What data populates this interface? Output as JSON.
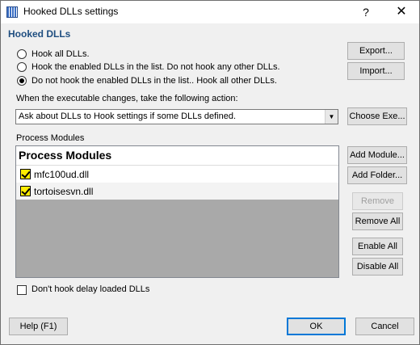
{
  "window": {
    "title": "Hooked DLLs settings",
    "help_glyph": "?",
    "close_glyph": "✕"
  },
  "section_title": "Hooked DLLs",
  "hook_options": [
    {
      "label": "Hook all DLLs.",
      "checked": false
    },
    {
      "label": "Hook the enabled DLLs in the list. Do not hook any other DLLs.",
      "checked": false
    },
    {
      "label": "Do not hook the enabled DLLs in the list.. Hook all other DLLs.",
      "checked": true
    }
  ],
  "buttons": {
    "export": "Export...",
    "import": "Import...",
    "choose_exe": "Choose Exe...",
    "add_module": "Add Module...",
    "add_folder": "Add Folder...",
    "remove": "Remove",
    "remove_all": "Remove All",
    "enable_all": "Enable All",
    "disable_all": "Disable All",
    "help": "Help (F1)",
    "ok": "OK",
    "cancel": "Cancel"
  },
  "exe_change": {
    "label": "When the executable changes, take the following action:",
    "selected": "Ask about DLLs to Hook settings if some DLLs defined."
  },
  "process_modules": {
    "group_label": "Process Modules",
    "header": "Process Modules",
    "items": [
      {
        "name": "mfc100ud.dll",
        "checked": true
      },
      {
        "name": "tortoisesvn.dll",
        "checked": true
      }
    ]
  },
  "delay_loaded": {
    "label": "Don't hook delay loaded DLLs",
    "checked": false
  },
  "icons": {
    "app": "app-icon",
    "dropdown": "chevron-down-icon",
    "check": "check-icon"
  }
}
